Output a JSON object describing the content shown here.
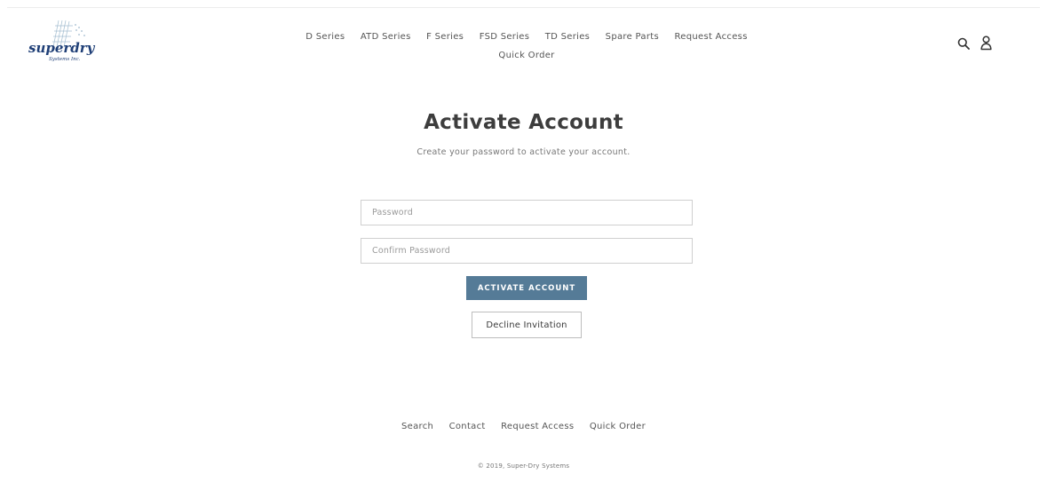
{
  "brand": {
    "logo_text": "superdry",
    "logo_sub": "Systems Inc.",
    "accent": "#557b97"
  },
  "nav": {
    "items": [
      "D Series",
      "ATD Series",
      "F Series",
      "FSD Series",
      "TD Series",
      "Spare Parts",
      "Request Access",
      "Quick Order"
    ]
  },
  "header_icons": [
    "search-icon",
    "account-icon"
  ],
  "main": {
    "title": "Activate Account",
    "subtitle": "Create your password to activate your account.",
    "password_placeholder": "Password",
    "confirm_placeholder": "Confirm Password",
    "activate_label": "ACTIVATE ACCOUNT",
    "decline_label": "Decline Invitation"
  },
  "footer": {
    "links": [
      "Search",
      "Contact",
      "Request Access",
      "Quick Order"
    ],
    "copyright": "© 2019, Super-Dry Systems"
  }
}
